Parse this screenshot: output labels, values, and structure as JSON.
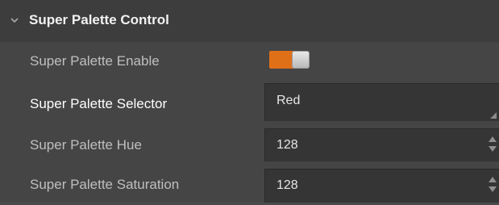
{
  "section": {
    "title": "Super Palette Control",
    "icon": "chevron-down-icon",
    "expanded": true
  },
  "rows": {
    "enable": {
      "label": "Super Palette Enable",
      "value": true,
      "accent_color": "#e07018"
    },
    "selector": {
      "label": "Super Palette Selector",
      "value": "Red"
    },
    "hue": {
      "label": "Super Palette Hue",
      "value": "128"
    },
    "saturation": {
      "label": "Super Palette Saturation",
      "value": "128"
    }
  }
}
